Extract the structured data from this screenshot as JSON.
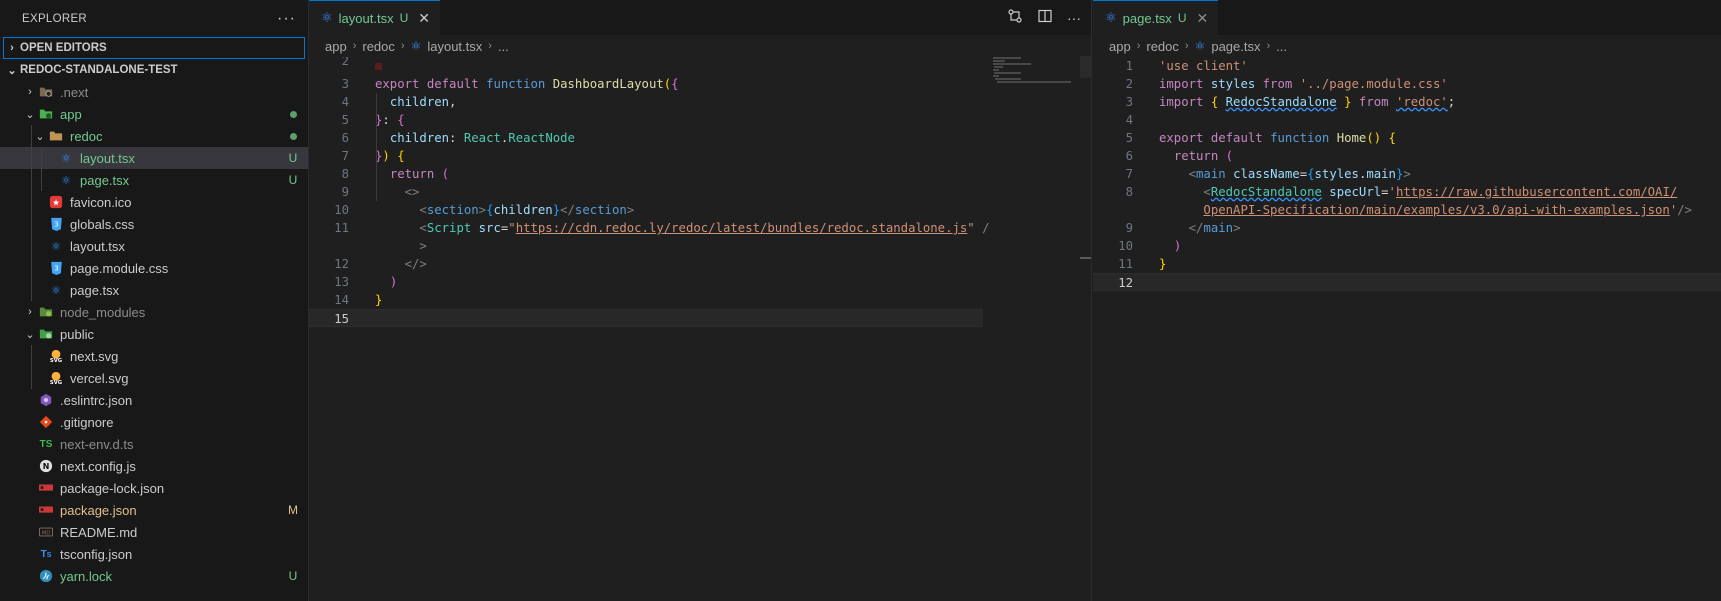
{
  "sidebar": {
    "title": "EXPLORER",
    "more": "···",
    "open_editors": "OPEN EDITORS",
    "project": "REDOC-STANDALONE-TEST",
    "items": [
      {
        "label": ".next",
        "depth": 1,
        "kind": "folder-next",
        "chev": "›",
        "badge": ""
      },
      {
        "label": "app",
        "depth": 1,
        "kind": "folder-app",
        "chev": "⌄",
        "badge": "dot"
      },
      {
        "label": "redoc",
        "depth": 2,
        "kind": "folder",
        "chev": "⌄",
        "badge": "dot"
      },
      {
        "label": "layout.tsx",
        "depth": 3,
        "kind": "react",
        "chev": "",
        "badge": "U"
      },
      {
        "label": "page.tsx",
        "depth": 3,
        "kind": "react",
        "chev": "",
        "badge": "U"
      },
      {
        "label": "favicon.ico",
        "depth": 2,
        "kind": "favicon",
        "chev": "",
        "badge": ""
      },
      {
        "label": "globals.css",
        "depth": 2,
        "kind": "css",
        "chev": "",
        "badge": ""
      },
      {
        "label": "layout.tsx",
        "depth": 2,
        "kind": "react",
        "chev": "",
        "badge": ""
      },
      {
        "label": "page.module.css",
        "depth": 2,
        "kind": "css",
        "chev": "",
        "badge": ""
      },
      {
        "label": "page.tsx",
        "depth": 2,
        "kind": "react",
        "chev": "",
        "badge": ""
      },
      {
        "label": "node_modules",
        "depth": 1,
        "kind": "folder-node",
        "chev": "›",
        "badge": ""
      },
      {
        "label": "public",
        "depth": 1,
        "kind": "folder-public",
        "chev": "⌄",
        "badge": ""
      },
      {
        "label": "next.svg",
        "depth": 2,
        "kind": "svg",
        "chev": "",
        "badge": ""
      },
      {
        "label": "vercel.svg",
        "depth": 2,
        "kind": "svg",
        "chev": "",
        "badge": ""
      },
      {
        "label": ".eslintrc.json",
        "depth": 1,
        "kind": "eslint",
        "chev": "",
        "badge": ""
      },
      {
        "label": ".gitignore",
        "depth": 1,
        "kind": "git",
        "chev": "",
        "badge": ""
      },
      {
        "label": "next-env.d.ts",
        "depth": 1,
        "kind": "ts",
        "chev": "",
        "badge": ""
      },
      {
        "label": "next.config.js",
        "depth": 1,
        "kind": "nextjs",
        "chev": "",
        "badge": ""
      },
      {
        "label": "package-lock.json",
        "depth": 1,
        "kind": "npm",
        "chev": "",
        "badge": ""
      },
      {
        "label": "package.json",
        "depth": 1,
        "kind": "npm",
        "chev": "",
        "badge": "M"
      },
      {
        "label": "README.md",
        "depth": 1,
        "kind": "md",
        "chev": "",
        "badge": ""
      },
      {
        "label": "tsconfig.json",
        "depth": 1,
        "kind": "tsconfig",
        "chev": "",
        "badge": ""
      },
      {
        "label": "yarn.lock",
        "depth": 1,
        "kind": "yarn",
        "chev": "",
        "badge": "U"
      }
    ]
  },
  "left_editor": {
    "tab_name": "layout.tsx",
    "tab_badge": "U",
    "close": "✕",
    "breadcrumb": [
      "app",
      "redoc",
      "layout.tsx",
      "..."
    ],
    "line_numbers": [
      "2",
      "3",
      "4",
      "5",
      "6",
      "7",
      "8",
      "9",
      "10",
      "11",
      "",
      "12",
      "13",
      "14",
      "15"
    ],
    "current_line": "15"
  },
  "right_editor": {
    "tab_name": "page.tsx",
    "tab_badge": "U",
    "close": "✕",
    "breadcrumb": [
      "app",
      "redoc",
      "page.tsx",
      "..."
    ],
    "line_numbers": [
      "1",
      "2",
      "3",
      "4",
      "5",
      "6",
      "7",
      "8",
      "",
      "9",
      "10",
      "11",
      "12"
    ],
    "current_line": "12"
  },
  "colors": {
    "accent": "#0078d4",
    "untracked": "#73c991",
    "modified": "#e2c08d"
  },
  "icons": [
    "ellipsis-icon",
    "chevron-right-icon",
    "chevron-down-icon",
    "react-icon",
    "folder-icon",
    "css-icon",
    "star-icon",
    "svg-icon",
    "eslint-icon",
    "git-icon",
    "ts-icon",
    "nextjs-icon",
    "npm-icon",
    "markdown-icon",
    "tsconfig-icon",
    "yarn-icon",
    "compare-changes-icon",
    "split-editor-icon",
    "more-actions-icon",
    "close-icon"
  ]
}
